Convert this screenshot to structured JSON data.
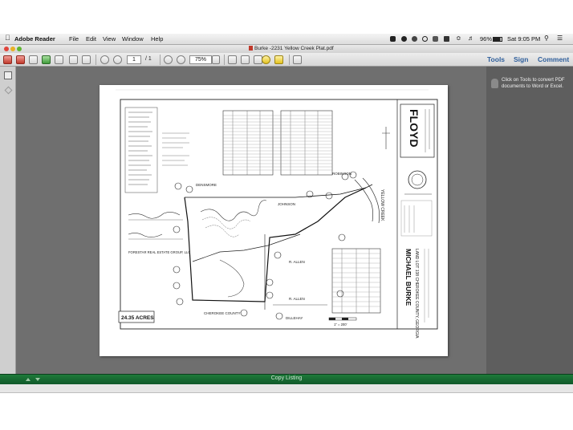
{
  "menubar": {
    "app_name": "Adobe Reader",
    "menus": [
      "File",
      "Edit",
      "View",
      "Window",
      "Help"
    ],
    "battery": "96%",
    "clock": "Sat 9:05 PM"
  },
  "window": {
    "document_title": "Burke -2231 Yellow Creek Plat.pdf"
  },
  "toolbar": {
    "page_number": "1",
    "page_total": "/ 1",
    "zoom": "75%",
    "tools_label": "Tools",
    "sign_label": "Sign",
    "comment_label": "Comment"
  },
  "tools_tip": {
    "text": "Click on Tools to convert PDF documents to Word or Excel."
  },
  "plat": {
    "firm_logo": "FLOYD",
    "acreage_box": "24.35 ACRES",
    "surveyor_name": "MICHAEL BURKE",
    "survey_location": "LAND LOT 138 CHEROKEE COUNTY, GEORGIA",
    "owner_tract_a": "DENSMORE",
    "owner_tract_b": "JOHNSON",
    "owner_tract_c": "ROBINSON",
    "owner_tract_d": "R. ALLEN",
    "owner_tract_e": "R. ALLEN",
    "owner_tract_f": "CHEROKEE COUNTY",
    "owner_tract_g": "DILLEHAY",
    "owner_tract_h": "FORESTAR REAL ESTATE GROUP, LLC",
    "road_name": "YELLOW CREEK",
    "scale_label": "1\" = 200'"
  },
  "bottom_bar": {
    "label": "Copy Listing"
  },
  "colors": {
    "canvas": "#6f6f6f",
    "link_blue": "#2f5f9c",
    "listing_bar": "#157034"
  }
}
